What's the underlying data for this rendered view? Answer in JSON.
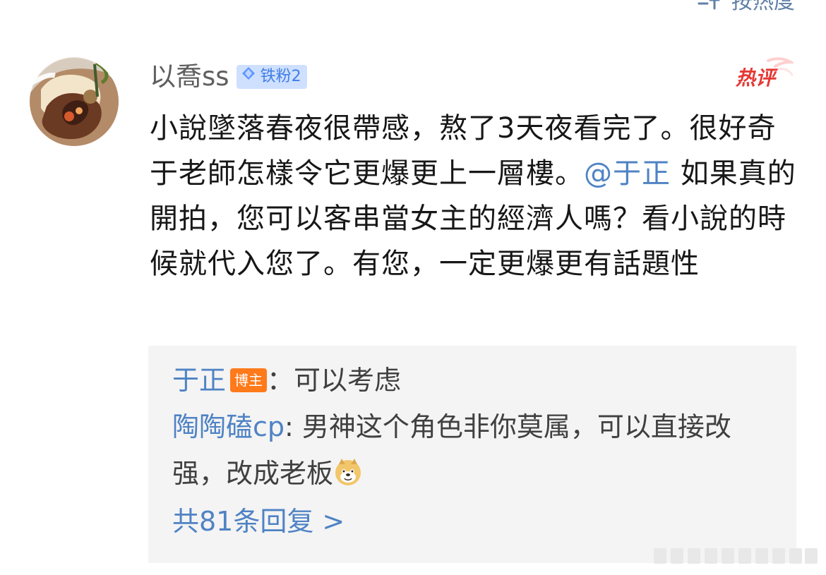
{
  "sort": {
    "label": "按热度",
    "icon": "sort-lines-icon"
  },
  "avatar": {
    "icon": "avatar-food-icon"
  },
  "comment": {
    "username": "以喬ss",
    "fan_badge": {
      "label": "铁粉2",
      "icon": "diamond-icon"
    },
    "hot_label": "热评",
    "text_part1": "小說墜落春夜很帶感，熬了3天夜看完了。很好奇于老師怎樣令它更爆更上一層樓。",
    "mention": "@于正",
    "text_part2": " 如果真的開拍，您可以客串當女主的經濟人嗎？看小說的時候就代入您了。有您，一定更爆更有話題性"
  },
  "replies": [
    {
      "user": "于正",
      "badge": "博主",
      "text": "：可以考虑"
    },
    {
      "user": "陶陶磕cp",
      "text": ": 男神这个角色非你莫属，可以直接改强，改成老板",
      "emoji": "doge-icon"
    }
  ],
  "more_replies": "共81条回复 >",
  "colors": {
    "link": "#4f83c4",
    "text": "#171717",
    "badge_orange": "#ff7a1a",
    "fan_badge_bg": "#cfe0ff",
    "fan_badge_text": "#3f7ee8",
    "hot_red": "#e53935",
    "reply_bg": "#f4f4f4"
  }
}
